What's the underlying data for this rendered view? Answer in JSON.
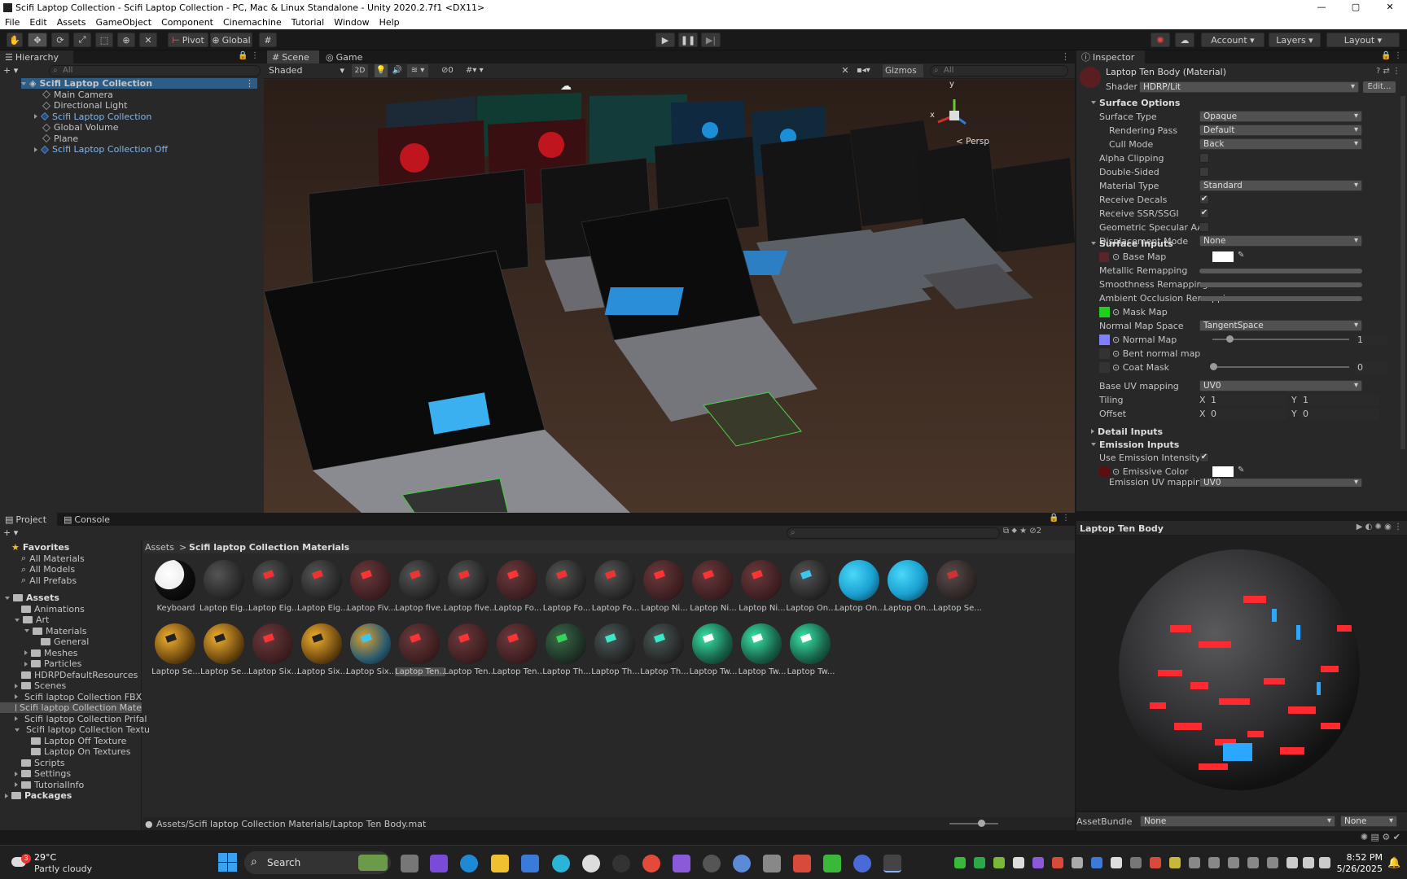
{
  "window": {
    "title": "Scifi Laptop Collection - Scifi Laptop Collection - PC, Mac & Linux Standalone - Unity 2020.2.7f1 <DX11>",
    "controls": [
      "—",
      "▢",
      "✕"
    ]
  },
  "menu": [
    "File",
    "Edit",
    "Assets",
    "GameObject",
    "Component",
    "Cinemachine",
    "Tutorial",
    "Window",
    "Help"
  ],
  "toolbar": {
    "pivot": "Pivot",
    "global": "Global",
    "account": "Account",
    "layers": "Layers",
    "layout": "Layout"
  },
  "hierarchy": {
    "tab": "Hierarchy",
    "search_placeholder": "All",
    "scene": "Scifi Laptop Collection",
    "items": [
      {
        "label": "Main Camera",
        "prefab": false,
        "expandable": false
      },
      {
        "label": "Directional Light",
        "prefab": false,
        "expandable": false
      },
      {
        "label": "Scifi Laptop Collection",
        "prefab": true,
        "expandable": true
      },
      {
        "label": "Global Volume",
        "prefab": false,
        "expandable": false
      },
      {
        "label": "Plane",
        "prefab": false,
        "expandable": false
      },
      {
        "label": "Scifi Laptop Collection Off",
        "prefab": true,
        "expandable": true
      }
    ]
  },
  "scene": {
    "tabs": [
      "Scene",
      "Game"
    ],
    "shading": "Shaded",
    "mode2d": "2D",
    "hidden_count": "0",
    "gizmos": "Gizmos",
    "search_placeholder": "All",
    "persp": "< Persp",
    "axis": {
      "x": "x",
      "y": "y"
    }
  },
  "inspector": {
    "tab": "Inspector",
    "material_name": "Laptop Ten Body (Material)",
    "shader_label": "Shader",
    "shader_value": "HDRP/Lit",
    "edit": "Edit...",
    "surface_options": "Surface Options",
    "rows1": [
      {
        "label": "Surface Type",
        "kind": "drop",
        "value": "Opaque"
      },
      {
        "label": "Rendering Pass",
        "kind": "drop",
        "value": "Default",
        "indent": true
      },
      {
        "label": "Cull Mode",
        "kind": "drop",
        "value": "Back",
        "indent": true
      },
      {
        "label": "Alpha Clipping",
        "kind": "chk",
        "value": ""
      },
      {
        "label": "Double-Sided",
        "kind": "chk",
        "value": ""
      },
      {
        "label": "Material Type",
        "kind": "drop",
        "value": "Standard"
      },
      {
        "label": "Receive Decals",
        "kind": "chk",
        "value": "✔"
      },
      {
        "label": "Receive SSR/SSGI",
        "kind": "chk",
        "value": "✔"
      },
      {
        "label": "Geometric Specular AA",
        "kind": "chk",
        "value": ""
      },
      {
        "label": "Displacement Mode",
        "kind": "drop",
        "value": "None"
      }
    ],
    "surface_inputs": "Surface Inputs",
    "base_map": "Base Map",
    "metallic": "Metallic Remapping",
    "smoothness": "Smoothness Remapping",
    "ao": "Ambient Occlusion Remappi",
    "mask_map": "Mask Map",
    "normal_space_label": "Normal Map Space",
    "normal_space": "TangentSpace",
    "normal_map": "Normal Map",
    "normal_value": "1",
    "bent_normal": "Bent normal map",
    "coat_mask": "Coat Mask",
    "coat_value": "0",
    "base_uv_label": "Base UV mapping",
    "base_uv": "UV0",
    "tiling": "Tiling",
    "offset": "Offset",
    "x": "X",
    "y": "Y",
    "tiling_x": "1",
    "tiling_y": "1",
    "offset_x": "0",
    "offset_y": "0",
    "detail_inputs": "Detail Inputs",
    "emission_inputs": "Emission Inputs",
    "use_emission": "Use Emission Intensity",
    "emissive_color": "Emissive Color",
    "emission_uv_label": "Emission UV mapping",
    "emission_uv": "UV0",
    "preview_title": "Laptop Ten Body",
    "assetbundle_label": "AssetBundle",
    "assetbundle": "None",
    "assetbundle_variant": "None",
    "colors": {
      "mask": "#1ed11e",
      "normal": "#8080ff",
      "base": "#ffffff"
    }
  },
  "project": {
    "tabs": [
      "Project",
      "Console"
    ],
    "hidden_count": "2",
    "tree": [
      {
        "label": "Favorites",
        "depth": 0,
        "kind": "star",
        "bold": true
      },
      {
        "label": "All Materials",
        "depth": 1,
        "kind": "search"
      },
      {
        "label": "All Models",
        "depth": 1,
        "kind": "search"
      },
      {
        "label": "All Prefabs",
        "depth": 1,
        "kind": "search"
      },
      {
        "label": "",
        "depth": 0,
        "kind": "spacer"
      },
      {
        "label": "Assets",
        "depth": 0,
        "kind": "folder",
        "bold": true,
        "open": true
      },
      {
        "label": "Animations",
        "depth": 1,
        "kind": "folder"
      },
      {
        "label": "Art",
        "depth": 1,
        "kind": "folder",
        "open": true
      },
      {
        "label": "Materials",
        "depth": 2,
        "kind": "folder",
        "open": true
      },
      {
        "label": "General",
        "depth": 3,
        "kind": "folder"
      },
      {
        "label": "Meshes",
        "depth": 2,
        "kind": "folder",
        "closed": true
      },
      {
        "label": "Particles",
        "depth": 2,
        "kind": "folder",
        "closed": true
      },
      {
        "label": "HDRPDefaultResources",
        "depth": 1,
        "kind": "folder"
      },
      {
        "label": "Scenes",
        "depth": 1,
        "kind": "folder",
        "closed": true
      },
      {
        "label": "Scifi laptop Collection FBX",
        "depth": 1,
        "kind": "folder",
        "closed": true
      },
      {
        "label": "Scifi laptop Collection Mate",
        "depth": 1,
        "kind": "folder",
        "selected": true
      },
      {
        "label": "Scifi laptop Collection Prifal",
        "depth": 1,
        "kind": "folder",
        "closed": true
      },
      {
        "label": "Scifi laptop Collection Textu",
        "depth": 1,
        "kind": "folder",
        "open": true
      },
      {
        "label": "Laptop Off Texture",
        "depth": 2,
        "kind": "folder"
      },
      {
        "label": "Laptop On Textures",
        "depth": 2,
        "kind": "folder"
      },
      {
        "label": "Scripts",
        "depth": 1,
        "kind": "folder"
      },
      {
        "label": "Settings",
        "depth": 1,
        "kind": "folder",
        "closed": true
      },
      {
        "label": "TutorialInfo",
        "depth": 1,
        "kind": "folder",
        "closed": true
      },
      {
        "label": "Packages",
        "depth": 0,
        "kind": "folder",
        "bold": true,
        "closed": true
      }
    ],
    "breadcrumb": [
      "Assets",
      "Scifi laptop Collection Materials"
    ],
    "assets": [
      {
        "label": "Keyboard",
        "style": "keyboard"
      },
      {
        "label": "Laptop Eig...",
        "style": "dark"
      },
      {
        "label": "Laptop Eig...",
        "style": "red-lite"
      },
      {
        "label": "Laptop Eig...",
        "style": "red-lite"
      },
      {
        "label": "Laptop Fiv...",
        "style": "red"
      },
      {
        "label": "Laptop five...",
        "style": "red-lite"
      },
      {
        "label": "Laptop five...",
        "style": "red-lite"
      },
      {
        "label": "Laptop Fo...",
        "style": "red"
      },
      {
        "label": "Laptop Fo...",
        "style": "red-lite"
      },
      {
        "label": "Laptop Fo...",
        "style": "red-lite"
      },
      {
        "label": "Laptop Ni...",
        "style": "red"
      },
      {
        "label": "Laptop Ni...",
        "style": "red"
      },
      {
        "label": "Laptop Ni...",
        "style": "red"
      },
      {
        "label": "Laptop On...",
        "style": "cyan-lite"
      },
      {
        "label": "Laptop On...",
        "style": "cyan"
      },
      {
        "label": "Laptop On...",
        "style": "cyan"
      },
      {
        "label": "Laptop Se...",
        "style": "mixed"
      },
      {
        "label": "Laptop Se...",
        "style": "orange"
      },
      {
        "label": "Laptop Se...",
        "style": "orange"
      },
      {
        "label": "Laptop Six...",
        "style": "red"
      },
      {
        "label": "Laptop Six...",
        "style": "orange"
      },
      {
        "label": "Laptop Six...",
        "style": "cyanorange"
      },
      {
        "label": "Laptop Ten...",
        "style": "red",
        "selected": true
      },
      {
        "label": "Laptop Ten...",
        "style": "red"
      },
      {
        "label": "Laptop Ten...",
        "style": "red"
      },
      {
        "label": "Laptop Th...",
        "style": "green"
      },
      {
        "label": "Laptop Th...",
        "style": "teal-lite"
      },
      {
        "label": "Laptop Th...",
        "style": "teal-lite"
      },
      {
        "label": "Laptop Tw...",
        "style": "teal"
      },
      {
        "label": "Laptop Tw...",
        "style": "teal"
      },
      {
        "label": "Laptop Tw...",
        "style": "teal"
      }
    ],
    "status_path": "Assets/Scifi laptop Collection Materials/Laptop Ten Body.mat"
  },
  "taskbar": {
    "weather_temp": "29°C",
    "weather_desc": "Partly cloudy",
    "weather_badge": "3",
    "search": "Search",
    "time": "8:52 PM",
    "date": "5/26/2025"
  }
}
